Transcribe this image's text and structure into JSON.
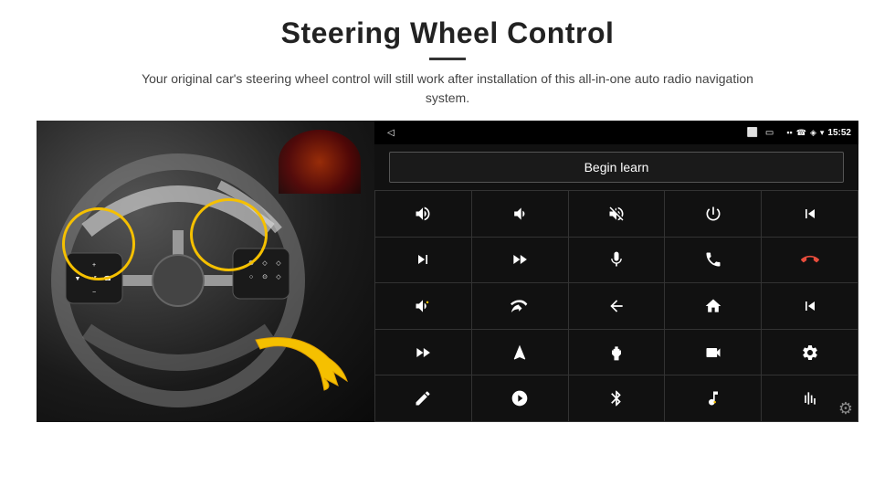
{
  "page": {
    "title": "Steering Wheel Control",
    "subtitle": "Your original car's steering wheel control will still work after installation of this all-in-one auto radio navigation system.",
    "divider_color": "#333"
  },
  "status_bar": {
    "time": "15:52",
    "back_symbol": "◁",
    "window_symbol": "⬜",
    "square_symbol": "▭",
    "signal_symbol": "▪▪",
    "phone_symbol": "📞",
    "location_symbol": "◈",
    "wifi_symbol": "▾"
  },
  "begin_learn": {
    "label": "Begin learn"
  },
  "grid_icons": [
    {
      "id": "vol-up",
      "symbol": "🔊+",
      "unicode": "vol_up"
    },
    {
      "id": "vol-down",
      "symbol": "🔉−",
      "unicode": "vol_down"
    },
    {
      "id": "mute",
      "symbol": "🔇×",
      "unicode": "mute"
    },
    {
      "id": "power",
      "symbol": "⏻",
      "unicode": "power"
    },
    {
      "id": "prev-track",
      "symbol": "⏮",
      "unicode": "prev"
    },
    {
      "id": "next-track",
      "symbol": "⏭",
      "unicode": "next"
    },
    {
      "id": "ff",
      "symbol": "⏩",
      "unicode": "ff"
    },
    {
      "id": "mic",
      "symbol": "🎤",
      "unicode": "mic"
    },
    {
      "id": "phone",
      "symbol": "📞",
      "unicode": "phone"
    },
    {
      "id": "hang-up",
      "symbol": "📵",
      "unicode": "hangup"
    },
    {
      "id": "horn",
      "symbol": "📣",
      "unicode": "horn"
    },
    {
      "id": "360",
      "symbol": "🔄",
      "unicode": "360"
    },
    {
      "id": "back",
      "symbol": "↩",
      "unicode": "back"
    },
    {
      "id": "home",
      "symbol": "⌂",
      "unicode": "home"
    },
    {
      "id": "prev-chapter",
      "symbol": "⏮⏮",
      "unicode": "prev2"
    },
    {
      "id": "fast-fwd2",
      "symbol": "⏭⏭",
      "unicode": "ff2"
    },
    {
      "id": "navigate",
      "symbol": "➤",
      "unicode": "nav"
    },
    {
      "id": "equalizer",
      "symbol": "⇄",
      "unicode": "eq"
    },
    {
      "id": "camera",
      "symbol": "📷",
      "unicode": "cam"
    },
    {
      "id": "settings2",
      "symbol": "⚙",
      "unicode": "settings2"
    },
    {
      "id": "edit",
      "symbol": "✏",
      "unicode": "edit"
    },
    {
      "id": "target",
      "symbol": "⊙",
      "unicode": "target"
    },
    {
      "id": "bluetooth",
      "symbol": "⚡",
      "unicode": "bt"
    },
    {
      "id": "music",
      "symbol": "♫",
      "unicode": "music"
    },
    {
      "id": "bars",
      "symbol": "📊",
      "unicode": "bars"
    }
  ],
  "settings": {
    "gear_symbol": "⚙"
  }
}
